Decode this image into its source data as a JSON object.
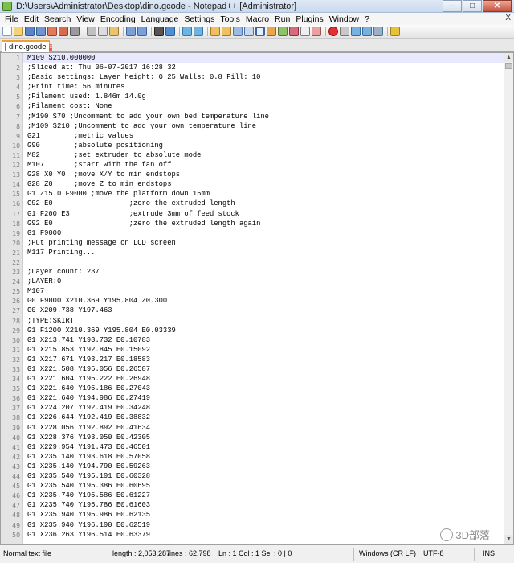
{
  "window": {
    "title": "D:\\Users\\Administrator\\Desktop\\dino.gcode - Notepad++ [Administrator]",
    "buttons": {
      "minimize": "–",
      "maximize": "□",
      "close": "✕"
    }
  },
  "menu": {
    "items": [
      "File",
      "Edit",
      "Search",
      "View",
      "Encoding",
      "Language",
      "Settings",
      "Tools",
      "Macro",
      "Run",
      "Plugins",
      "Window",
      "?"
    ],
    "right_close": "X"
  },
  "tab": {
    "label": "dino.gcode",
    "close": "x"
  },
  "editor": {
    "lines": [
      {
        "n": "1",
        "t": "M109 S210.000000"
      },
      {
        "n": "2",
        "t": ";Sliced at: Thu 06-07-2017 16:28:32"
      },
      {
        "n": "3",
        "t": ";Basic settings: Layer height: 0.25 Walls: 0.8 Fill: 10"
      },
      {
        "n": "4",
        "t": ";Print time: 56 minutes"
      },
      {
        "n": "5",
        "t": ";Filament used: 1.846m 14.0g"
      },
      {
        "n": "6",
        "t": ";Filament cost: None"
      },
      {
        "n": "7",
        "t": ";M190 S70 ;Uncomment to add your own bed temperature line"
      },
      {
        "n": "8",
        "t": ";M109 S210 ;Uncomment to add your own temperature line"
      },
      {
        "n": "9",
        "t": "G21        ;metric values"
      },
      {
        "n": "10",
        "t": "G90        ;absolute positioning"
      },
      {
        "n": "11",
        "t": "M82        ;set extruder to absolute mode"
      },
      {
        "n": "12",
        "t": "M107       ;start with the fan off"
      },
      {
        "n": "13",
        "t": "G28 X0 Y0  ;move X/Y to min endstops"
      },
      {
        "n": "14",
        "t": "G28 Z0     ;move Z to min endstops"
      },
      {
        "n": "15",
        "t": "G1 Z15.0 F9000 ;move the platform down 15mm"
      },
      {
        "n": "16",
        "t": "G92 E0                  ;zero the extruded length"
      },
      {
        "n": "17",
        "t": "G1 F200 E3              ;extrude 3mm of feed stock"
      },
      {
        "n": "18",
        "t": "G92 E0                  ;zero the extruded length again"
      },
      {
        "n": "19",
        "t": "G1 F9000"
      },
      {
        "n": "20",
        "t": ";Put printing message on LCD screen"
      },
      {
        "n": "21",
        "t": "M117 Printing..."
      },
      {
        "n": "22",
        "t": ""
      },
      {
        "n": "23",
        "t": ";Layer count: 237"
      },
      {
        "n": "24",
        "t": ";LAYER:0"
      },
      {
        "n": "25",
        "t": "M107"
      },
      {
        "n": "26",
        "t": "G0 F9000 X210.369 Y195.804 Z0.300"
      },
      {
        "n": "27",
        "t": "G0 X209.738 Y197.463"
      },
      {
        "n": "28",
        "t": ";TYPE:SKIRT"
      },
      {
        "n": "29",
        "t": "G1 F1200 X210.369 Y195.804 E0.03339"
      },
      {
        "n": "30",
        "t": "G1 X213.741 Y193.732 E0.10783"
      },
      {
        "n": "31",
        "t": "G1 X215.853 Y192.845 E0.15092"
      },
      {
        "n": "32",
        "t": "G1 X217.671 Y193.217 E0.18583"
      },
      {
        "n": "33",
        "t": "G1 X221.508 Y195.056 E0.26587"
      },
      {
        "n": "34",
        "t": "G1 X221.604 Y195.222 E0.26948"
      },
      {
        "n": "35",
        "t": "G1 X221.640 Y195.186 E0.27043"
      },
      {
        "n": "36",
        "t": "G1 X221.640 Y194.986 E0.27419"
      },
      {
        "n": "37",
        "t": "G1 X224.207 Y192.419 E0.34248"
      },
      {
        "n": "38",
        "t": "G1 X226.644 Y192.419 E0.38832"
      },
      {
        "n": "39",
        "t": "G1 X228.056 Y192.892 E0.41634"
      },
      {
        "n": "40",
        "t": "G1 X228.376 Y193.050 E0.42305"
      },
      {
        "n": "41",
        "t": "G1 X229.954 Y191.473 E0.46501"
      },
      {
        "n": "42",
        "t": "G1 X235.140 Y193.618 E0.57058"
      },
      {
        "n": "43",
        "t": "G1 X235.140 Y194.790 E0.59263"
      },
      {
        "n": "44",
        "t": "G1 X235.540 Y195.191 E0.60328"
      },
      {
        "n": "45",
        "t": "G1 X235.540 Y195.386 E0.60695"
      },
      {
        "n": "46",
        "t": "G1 X235.740 Y195.586 E0.61227"
      },
      {
        "n": "47",
        "t": "G1 X235.740 Y195.786 E0.61603"
      },
      {
        "n": "48",
        "t": "G1 X235.940 Y195.986 E0.62135"
      },
      {
        "n": "49",
        "t": "G1 X235.940 Y196.190 E0.62519"
      },
      {
        "n": "50",
        "t": "G1 X236.263 Y196.514 E0.63379"
      }
    ]
  },
  "status": {
    "type": "Normal text file",
    "length": "length : 2,053,287",
    "lines": "lines : 62,798",
    "position": "Ln : 1    Col : 1    Sel : 0 | 0",
    "eol": "Windows (CR LF)",
    "encoding": "UTF-8",
    "mode": "INS"
  },
  "watermark": {
    "text": "3D部落"
  },
  "colors": {
    "current_line": "#e8e8ff",
    "gutter": "#e4e4e4",
    "tab_accent": "#f0a030"
  }
}
